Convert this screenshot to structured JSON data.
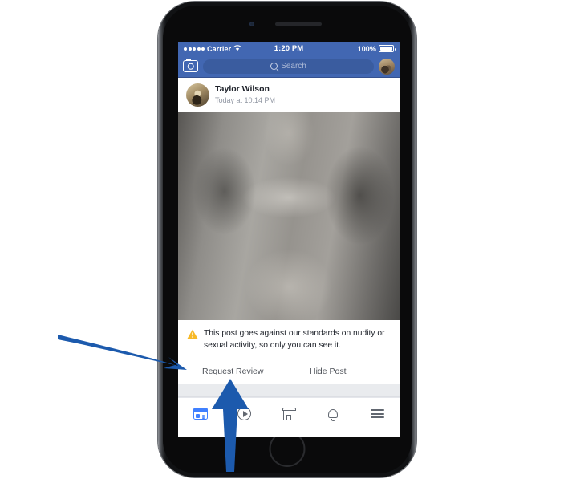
{
  "device": {
    "type": "iphone",
    "frame_name": "iphone-frame"
  },
  "status_bar": {
    "carrier": "Carrier",
    "signal_dots": 5,
    "wifi_icon": "wifi-icon",
    "time": "1:20 PM",
    "battery_percent": "100%",
    "battery_icon": "battery-full-icon"
  },
  "top_bar": {
    "camera_icon": "camera-icon",
    "search": {
      "icon": "search-icon",
      "placeholder": "Search",
      "value": ""
    },
    "avatar": "profile-avatar",
    "background_color": "#4267b2"
  },
  "post": {
    "author": "Taylor Wilson",
    "timestamp": "Today at 10:14 PM",
    "avatar": "author-avatar",
    "photo_alt": "grayscale-classical-statue-photo"
  },
  "warning": {
    "icon": "warning-triangle-icon",
    "icon_color": "#f7b928",
    "text": "This post goes against our standards on nudity or sexual activity, so only you can see it."
  },
  "actions": {
    "request_review": "Request Review",
    "hide_post": "Hide Post"
  },
  "tab_bar": {
    "items": [
      {
        "name": "news-feed",
        "icon": "news-feed-icon",
        "active": true
      },
      {
        "name": "watch",
        "icon": "video-play-icon",
        "active": false
      },
      {
        "name": "marketplace",
        "icon": "marketplace-store-icon",
        "active": false
      },
      {
        "name": "notifications",
        "icon": "bell-icon",
        "active": false
      },
      {
        "name": "menu",
        "icon": "hamburger-menu-icon",
        "active": false
      }
    ],
    "active_color": "#4080ff",
    "inactive_color": "#616770"
  },
  "annotations": {
    "color": "#1c5aad",
    "arrows": [
      {
        "name": "arrow-pointing-to-request-review-row",
        "direction": "right"
      },
      {
        "name": "arrow-pointing-up-to-request-review",
        "direction": "up"
      }
    ]
  }
}
